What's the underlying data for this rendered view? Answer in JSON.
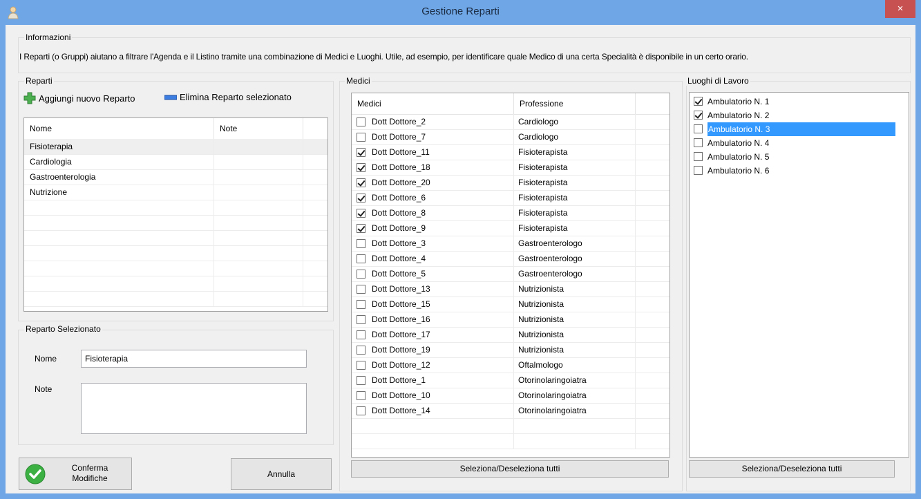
{
  "window": {
    "title": "Gestione Reparti",
    "close": "×"
  },
  "info": {
    "label": "Informazioni",
    "text": "I Reparti (o Gruppi) aiutano a filtrare l'Agenda e il Listino tramite una combinazione di Medici e Luoghi. Utile, ad esempio, per identificare quale Medico di una certa Specialità è disponibile in un certo orario."
  },
  "reparti": {
    "label": "Reparti",
    "add_label": "Aggiungi nuovo Reparto",
    "delete_label": "Elimina Reparto selezionato",
    "columns": [
      "Nome",
      "Note"
    ],
    "rows": [
      {
        "nome": "Fisioterapia",
        "note": ""
      },
      {
        "nome": "Cardiologia",
        "note": ""
      },
      {
        "nome": "Gastroenterologia",
        "note": ""
      },
      {
        "nome": "Nutrizione",
        "note": ""
      }
    ]
  },
  "selected": {
    "label": "Reparto Selezionato",
    "nome_label": "Nome",
    "nome_value": "Fisioterapia",
    "note_label": "Note",
    "note_value": ""
  },
  "buttons": {
    "confirm": "Conferma\nModifiche",
    "cancel": "Annulla"
  },
  "medici": {
    "label": "Medici",
    "columns": [
      "Medici",
      "Professione"
    ],
    "rows": [
      {
        "name": "Dott Dottore_2",
        "prof": "Cardiologo",
        "checked": false
      },
      {
        "name": "Dott Dottore_7",
        "prof": "Cardiologo",
        "checked": false
      },
      {
        "name": "Dott Dottore_11",
        "prof": "Fisioterapista",
        "checked": true
      },
      {
        "name": "Dott Dottore_18",
        "prof": "Fisioterapista",
        "checked": true
      },
      {
        "name": "Dott Dottore_20",
        "prof": "Fisioterapista",
        "checked": true
      },
      {
        "name": "Dott Dottore_6",
        "prof": "Fisioterapista",
        "checked": true
      },
      {
        "name": "Dott Dottore_8",
        "prof": "Fisioterapista",
        "checked": true
      },
      {
        "name": "Dott Dottore_9",
        "prof": "Fisioterapista",
        "checked": true
      },
      {
        "name": "Dott Dottore_3",
        "prof": "Gastroenterologo",
        "checked": false
      },
      {
        "name": "Dott Dottore_4",
        "prof": "Gastroenterologo",
        "checked": false
      },
      {
        "name": "Dott Dottore_5",
        "prof": "Gastroenterologo",
        "checked": false
      },
      {
        "name": "Dott Dottore_13",
        "prof": "Nutrizionista",
        "checked": false
      },
      {
        "name": "Dott Dottore_15",
        "prof": "Nutrizionista",
        "checked": false
      },
      {
        "name": "Dott Dottore_16",
        "prof": "Nutrizionista",
        "checked": false
      },
      {
        "name": "Dott Dottore_17",
        "prof": "Nutrizionista",
        "checked": false
      },
      {
        "name": "Dott Dottore_19",
        "prof": "Nutrizionista",
        "checked": false
      },
      {
        "name": "Dott Dottore_12",
        "prof": "Oftalmologo",
        "checked": false
      },
      {
        "name": "Dott Dottore_1",
        "prof": "Otorinolaringoiatra",
        "checked": false
      },
      {
        "name": "Dott Dottore_10",
        "prof": "Otorinolaringoiatra",
        "checked": false
      },
      {
        "name": "Dott Dottore_14",
        "prof": "Otorinolaringoiatra",
        "checked": false
      }
    ],
    "toggle_all": "Seleziona/Deseleziona tutti"
  },
  "luoghi": {
    "label": "Luoghi di Lavoro",
    "items": [
      {
        "name": "Ambulatorio N. 1",
        "checked": true,
        "selected": false
      },
      {
        "name": "Ambulatorio N. 2",
        "checked": true,
        "selected": false
      },
      {
        "name": "Ambulatorio N. 3",
        "checked": false,
        "selected": true
      },
      {
        "name": "Ambulatorio N. 4",
        "checked": false,
        "selected": false
      },
      {
        "name": "Ambulatorio N. 5",
        "checked": false,
        "selected": false
      },
      {
        "name": "Ambulatorio N. 6",
        "checked": false,
        "selected": false
      }
    ],
    "toggle_all": "Seleziona/Deseleziona tutti"
  },
  "colors": {
    "titlebar": "#6fa6e6",
    "selection": "#3399ff",
    "add_icon": "#4caf50",
    "delete_icon": "#3b7de0",
    "confirm_icon": "#3cb043"
  }
}
